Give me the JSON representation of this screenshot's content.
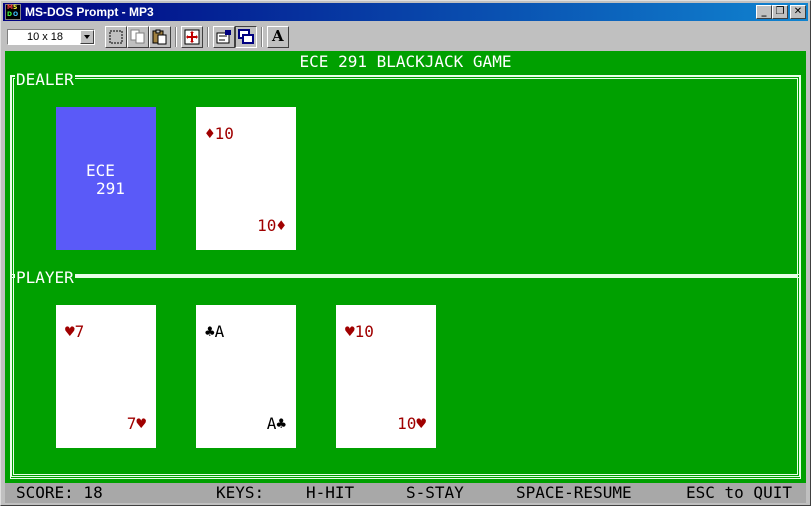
{
  "window": {
    "title": "MS-DOS Prompt - MP3",
    "icon_letters": [
      "M",
      "S",
      "D",
      "O",
      "S"
    ],
    "controls": {
      "minimize": "_",
      "restore": "❐",
      "close": "✕"
    }
  },
  "toolbar": {
    "font_size": "10 x 18",
    "buttons": [
      "mark-icon",
      "copy-icon",
      "paste-icon",
      "fullscreen-icon",
      "properties-icon",
      "background-icon",
      "font-icon"
    ],
    "font_button_label": "A"
  },
  "game": {
    "title": "ECE 291 BLACKJACK GAME",
    "dealer_label": "DEALER",
    "player_label": "PLAYER",
    "card_back": {
      "line1": "ECE",
      "line2": "291"
    },
    "dealer_cards": [
      {
        "top": "♦10",
        "bottom": "10♦",
        "color": "red"
      }
    ],
    "player_cards": [
      {
        "top": "♥7",
        "bottom": "7♥",
        "color": "red"
      },
      {
        "top": "♣A",
        "bottom": "A♣",
        "color": "black"
      },
      {
        "top": "♥10",
        "bottom": "10♥",
        "color": "red"
      }
    ]
  },
  "status_bar": {
    "score": "SCORE: 18",
    "keys": "KEYS:",
    "hit": "H-HIT",
    "stay": "S-STAY",
    "resume": "SPACE-RESUME",
    "quit": "ESC to QUIT"
  },
  "colors": {
    "screen_bg": "#00a000",
    "card_back": "#5a5af8",
    "red_suit": "#a00000",
    "status_bg": "#a8a8a8"
  }
}
